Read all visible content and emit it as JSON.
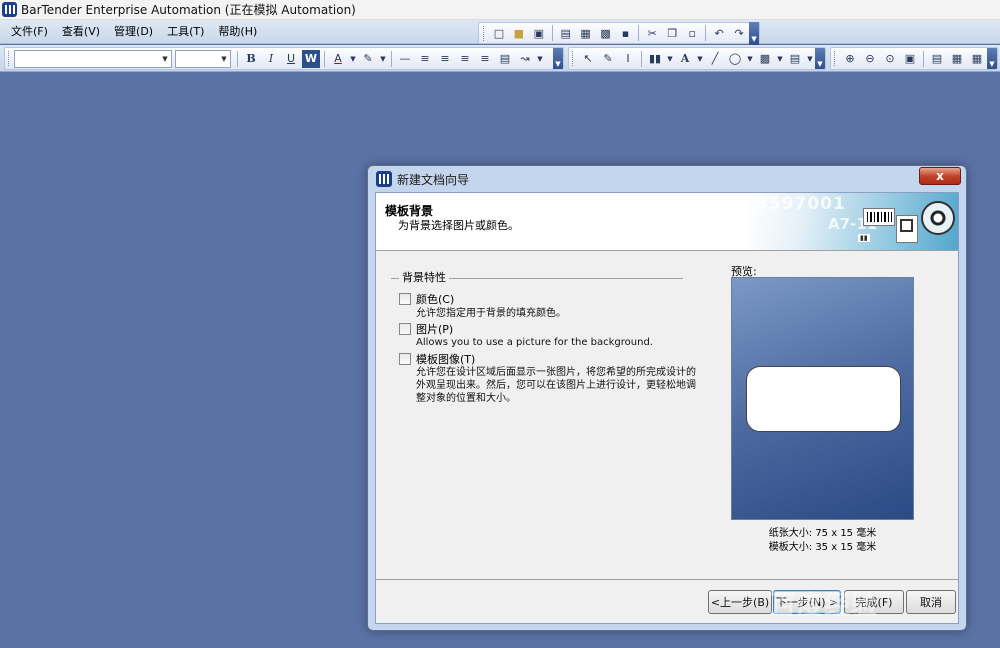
{
  "window": {
    "title": "BarTender Enterprise Automation (正在模拟 Automation)"
  },
  "menu": [
    {
      "label": "文件(F)"
    },
    {
      "label": "查看(V)"
    },
    {
      "label": "管理(D)"
    },
    {
      "label": "工具(T)"
    },
    {
      "label": "帮助(H)"
    }
  ],
  "format_toolbar": {
    "font_name": "",
    "font_size": "",
    "bold": "B",
    "italic": "I",
    "underline": "U",
    "word": "W",
    "font_color": "A"
  },
  "object_toolbar": {
    "text_tool": "A"
  },
  "dialog": {
    "title": "新建文档向导",
    "close_label": "x",
    "header_title": "模板背景",
    "header_subtitle": "为背景选择图片或颜色。",
    "banner_code": "3597001",
    "banner_code2": "A7-11",
    "group_label": "背景特性",
    "options": [
      {
        "label": "颜色(C)",
        "checked": false,
        "description": "允许您指定用于背景的填充颜色。"
      },
      {
        "label": "图片(P)",
        "checked": false,
        "description": "Allows you to use a picture for the background."
      },
      {
        "label": "模板图像(T)",
        "checked": false,
        "description": "允许您在设计区域后面显示一张图片，将您希望的所完成设计的外观呈现出来。然后，您可以在该图片上进行设计，更轻松地调整对象的位置和大小。"
      }
    ],
    "preview_label": "预览:",
    "paper_size": "纸张大小:  75 x 15 毫米",
    "template_size": "模板大小:  35 x 15 毫米",
    "buttons": {
      "back": "<上一步(B)",
      "next": "下一步(N) >",
      "finish": "完成(F)",
      "cancel": "取消"
    }
  },
  "watermark": "百度经验"
}
